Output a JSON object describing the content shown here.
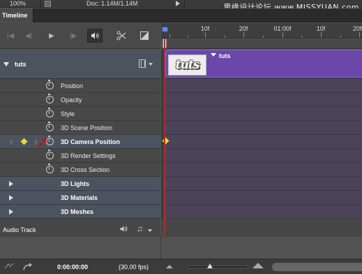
{
  "status": {
    "zoom": "100%",
    "doc": "Doc: 1.14M/1.14M"
  },
  "watermark": "思缘设计论坛 www.MISSYUAN.com",
  "panel": {
    "tab": "Timeline"
  },
  "toolbar": {
    "icons": [
      "go-to-first-frame-icon",
      "previous-frame-icon",
      "play-icon",
      "next-frame-icon",
      "audio-icon",
      "split-at-playhead-icon",
      "transition-icon"
    ]
  },
  "ruler": {
    "labels": [
      "10f",
      "20f",
      "01:00f",
      "10f",
      "20f"
    ]
  },
  "layer": {
    "name": "tuts",
    "clip_name": "tuts",
    "thumb_text": "tuts"
  },
  "properties": [
    "Position",
    "Opacity",
    "Style",
    "3D Scene Position",
    "3D Camera Position",
    "3D Render Settings",
    "3D Cross Section"
  ],
  "selected_property": "3D Camera Position",
  "groups": [
    "3D Lights",
    "3D Materials",
    "3D Meshes"
  ],
  "audio": {
    "label": "Audio Track"
  },
  "footer": {
    "time": "0:00:00:00",
    "fps": "(30.00 fps)",
    "zoom_level": 0.38
  },
  "colors": {
    "clip": "#6a47a8",
    "playhead": "#c8242c",
    "keyframe": "#f0d23a",
    "track": "#4b4458"
  }
}
